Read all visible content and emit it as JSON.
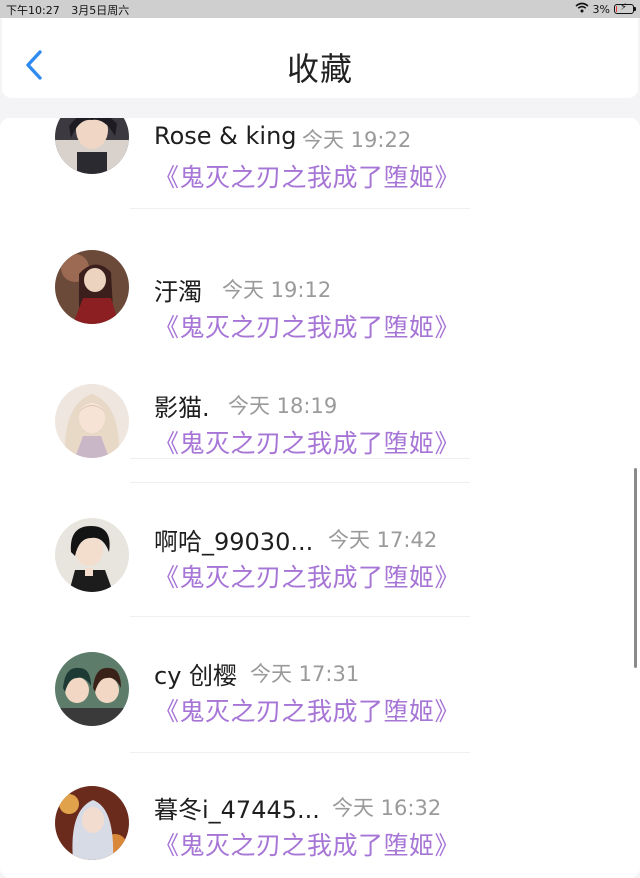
{
  "status_bar": {
    "time": "下午10:27",
    "date": "3月5日周六",
    "battery_text": "3%",
    "battery_level": 0.03
  },
  "header": {
    "title": "收藏",
    "back_icon": "chevron-left-icon"
  },
  "colors": {
    "accent_blue": "#2f8bf0",
    "book_title_purple": "#a675d6",
    "time_gray": "#9a9a9a"
  },
  "items": [
    {
      "name": "Rose & king",
      "time": "今天 19:22",
      "book": "《鬼灭之刃之我成了堕姬》"
    },
    {
      "name": "汙濁",
      "time": "今天 19:12",
      "book": "《鬼灭之刃之我成了堕姬》"
    },
    {
      "name": "影猫.",
      "time": "今天 18:19",
      "book": "《鬼灭之刃之我成了堕姬》"
    },
    {
      "name": "啊哈_99030...",
      "time": "今天 17:42",
      "book": "《鬼灭之刃之我成了堕姬》"
    },
    {
      "name": "cy 创樱",
      "time": "今天 17:31",
      "book": "《鬼灭之刃之我成了堕姬》"
    },
    {
      "name": "暮冬i_47445...",
      "time": "今天 16:32",
      "book": "《鬼灭之刃之我成了堕姬》"
    }
  ]
}
